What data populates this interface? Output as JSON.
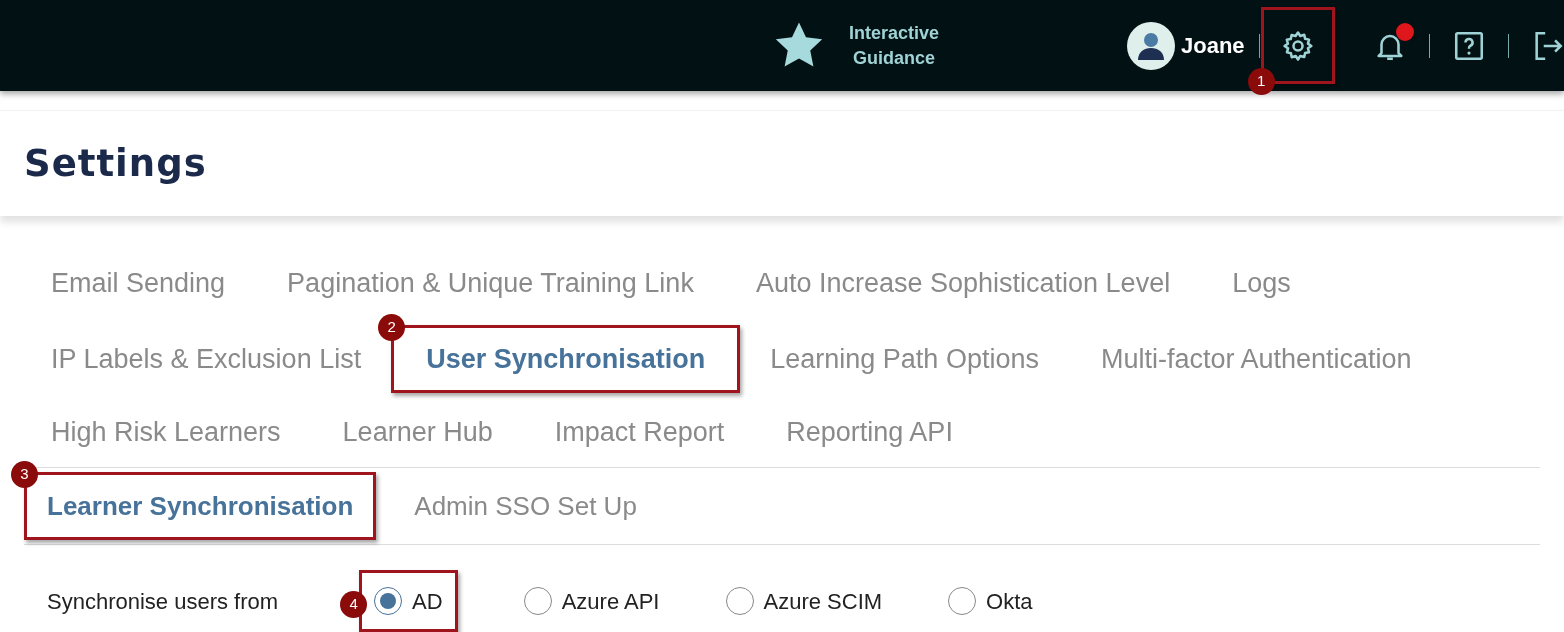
{
  "header": {
    "guidance": "Interactive Guidance",
    "user": "Joane",
    "icons": [
      {
        "kind": "gear",
        "callout": {
          "number": "1"
        }
      },
      {
        "kind": "bell",
        "notification": true
      },
      {
        "kind": "help"
      },
      {
        "kind": "logout"
      }
    ]
  },
  "page_title": "Settings",
  "tab_rows": [
    [
      {
        "label": "Email Sending",
        "selected": false
      },
      {
        "label": "Pagination & Unique Training Link",
        "selected": false
      },
      {
        "label": "Auto Increase Sophistication Level",
        "selected": false
      },
      {
        "label": "Logs",
        "selected": false
      }
    ],
    [
      {
        "label": "IP Labels & Exclusion List",
        "selected": false
      },
      {
        "label": "User Synchronisation",
        "selected": true,
        "callout": {
          "number": "2"
        }
      },
      {
        "label": "Learning Path Options",
        "selected": false
      },
      {
        "label": "Multi-factor Authentication",
        "selected": false
      }
    ],
    [
      {
        "label": "High Risk Learners",
        "selected": false
      },
      {
        "label": "Learner Hub",
        "selected": false
      },
      {
        "label": "Impact Report",
        "selected": false
      },
      {
        "label": "Reporting API",
        "selected": false
      }
    ]
  ],
  "sub_tabs": [
    {
      "label": "Learner Synchronisation",
      "selected": true,
      "callout": {
        "number": "3"
      }
    },
    {
      "label": "Admin SSO Set Up",
      "selected": false
    }
  ],
  "sync": {
    "label": "Synchronise users from",
    "options": [
      {
        "label": "AD",
        "selected": true,
        "callout": {
          "number": "4"
        }
      },
      {
        "label": "Azure API",
        "selected": false
      },
      {
        "label": "Azure SCIM",
        "selected": false
      },
      {
        "label": "Okta",
        "selected": false
      }
    ]
  }
}
